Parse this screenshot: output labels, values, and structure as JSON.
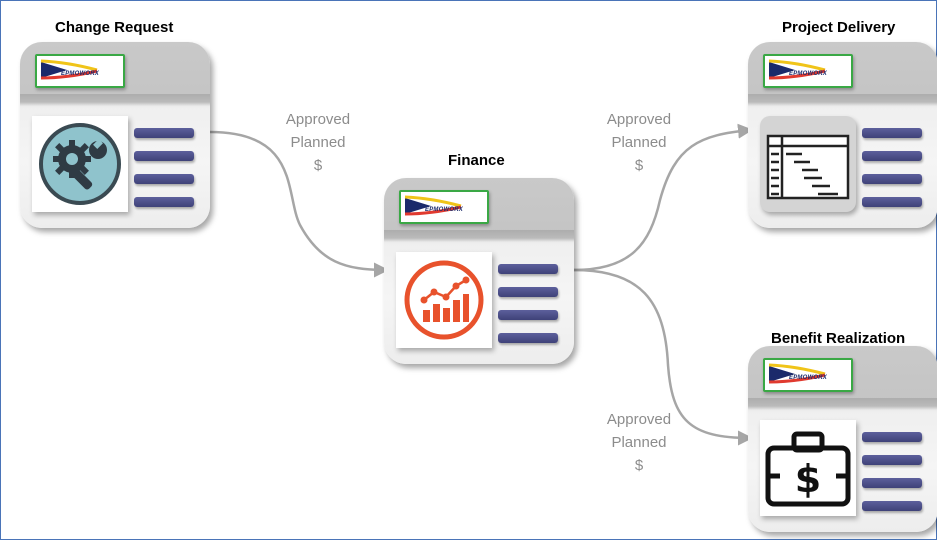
{
  "cards": {
    "change_request": {
      "title": "Change Request",
      "logo_text": "EPMOWORX",
      "icon": "gear-wrench-icon"
    },
    "finance": {
      "title": "Finance",
      "logo_text": "EPMOWORX",
      "icon": "chart-growth-icon"
    },
    "project_delivery": {
      "title": "Project Delivery",
      "logo_text": "EPMOWORX",
      "icon": "gantt-table-icon"
    },
    "benefit_realization": {
      "title": "Benefit Realization",
      "logo_text": "EPMOWORX",
      "icon": "money-briefcase-icon"
    }
  },
  "edges": [
    {
      "from": "Change Request",
      "to": "Finance",
      "lines": [
        "Approved",
        "Planned",
        "$"
      ]
    },
    {
      "from": "Finance",
      "to": "Project Delivery",
      "lines": [
        "Approved",
        "Planned",
        "$"
      ]
    },
    {
      "from": "Finance",
      "to": "Benefit Realization",
      "lines": [
        "Approved",
        "Planned",
        "$"
      ]
    }
  ],
  "colors": {
    "border": "#4a74b8",
    "connector": "#a6a6a6",
    "label": "#8c8c8c",
    "card_bar": "#464a85",
    "finance_icon": "#e8522c",
    "gear_circle": "#8fc3cc",
    "logo_border": "#3aa845"
  }
}
